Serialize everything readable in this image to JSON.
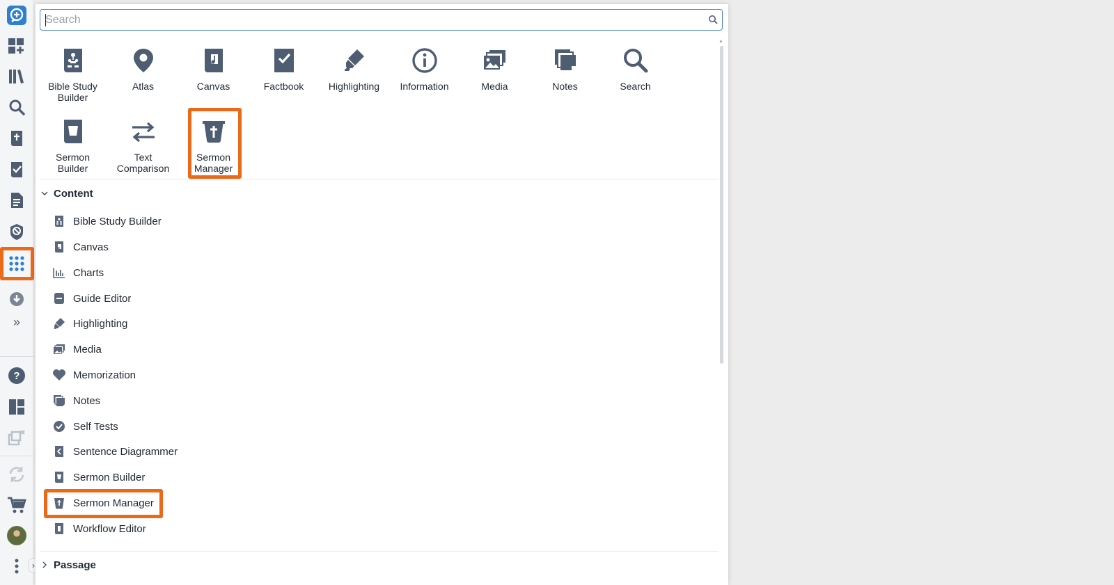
{
  "search": {
    "placeholder": "Search"
  },
  "tools": [
    {
      "label": "Bible Study Builder",
      "icon": "bible-study-builder-icon"
    },
    {
      "label": "Atlas",
      "icon": "atlas-icon"
    },
    {
      "label": "Canvas",
      "icon": "canvas-icon"
    },
    {
      "label": "Factbook",
      "icon": "factbook-icon"
    },
    {
      "label": "Highlighting",
      "icon": "highlighting-icon"
    },
    {
      "label": "Information",
      "icon": "information-icon"
    },
    {
      "label": "Media",
      "icon": "media-icon"
    },
    {
      "label": "Notes",
      "icon": "notes-icon"
    },
    {
      "label": "Search",
      "icon": "search-icon"
    },
    {
      "label": "Sermon Builder",
      "icon": "sermon-builder-icon"
    },
    {
      "label": "Text Comparison",
      "icon": "text-comparison-icon"
    },
    {
      "label": "Sermon Manager",
      "icon": "sermon-manager-icon",
      "highlighted": true
    }
  ],
  "sections": {
    "content": {
      "title": "Content",
      "expanded": true,
      "items": [
        {
          "label": "Bible Study Builder",
          "icon": "bible-study-builder-icon"
        },
        {
          "label": "Canvas",
          "icon": "canvas-icon"
        },
        {
          "label": "Charts",
          "icon": "charts-icon"
        },
        {
          "label": "Guide Editor",
          "icon": "guide-editor-icon"
        },
        {
          "label": "Highlighting",
          "icon": "highlighting-icon"
        },
        {
          "label": "Media",
          "icon": "media-icon"
        },
        {
          "label": "Memorization",
          "icon": "heart-icon"
        },
        {
          "label": "Notes",
          "icon": "notes-icon"
        },
        {
          "label": "Self Tests",
          "icon": "check-circle-icon"
        },
        {
          "label": "Sentence Diagrammer",
          "icon": "sentence-diagrammer-icon"
        },
        {
          "label": "Sermon Builder",
          "icon": "sermon-builder-icon"
        },
        {
          "label": "Sermon Manager",
          "icon": "sermon-manager-icon",
          "highlighted": true
        },
        {
          "label": "Workflow Editor",
          "icon": "workflow-editor-icon"
        }
      ]
    },
    "passage": {
      "title": "Passage",
      "expanded": false
    }
  },
  "rail": {
    "items": [
      "logos-logo",
      "dashboard-icon",
      "library-icon",
      "search-icon",
      "guides-icon",
      "factbook-icon",
      "documents-icon",
      "atlas-icon",
      "tools-grid-icon",
      "download-icon",
      "expand-icon",
      "help-icon",
      "layouts-icon",
      "close-panels-icon",
      "sync-icon",
      "cart-icon",
      "avatar",
      "more-icon"
    ],
    "active": "tools-grid-icon"
  },
  "colors": {
    "accent_highlight": "#ea6a1a",
    "icon": "#4f5d73",
    "brand_blue": "#2f7fd0",
    "search_border": "#4c86c8"
  }
}
